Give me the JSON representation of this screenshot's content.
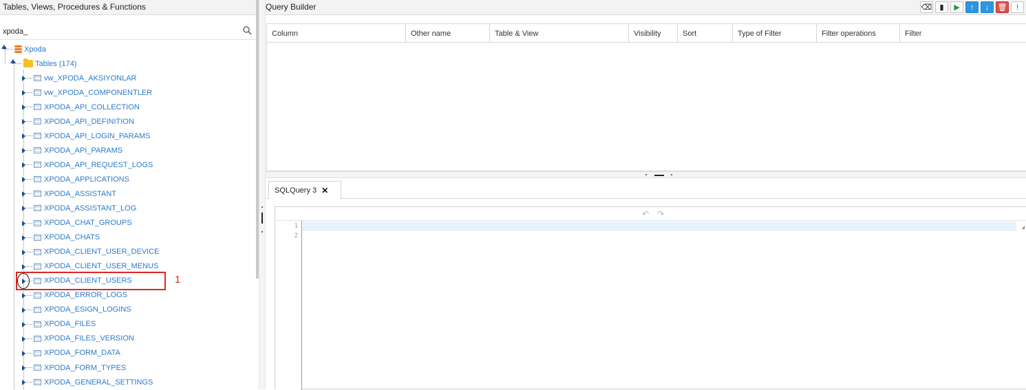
{
  "left_panel": {
    "title": "Tables, Views, Procedures & Functions",
    "search": {
      "value": "xpoda_",
      "icon": "search-icon"
    },
    "tree": {
      "root": {
        "label": "Xpoda",
        "icon": "database-icon"
      },
      "folder": {
        "label": "Tables (174)",
        "icon": "folder-icon"
      },
      "items": [
        "vw_XPODA_AKSIYONLAR",
        "vw_XPODA_COMPONENTLER",
        "XPODA_API_COLLECTION",
        "XPODA_API_DEFINITION",
        "XPODA_API_LOGIN_PARAMS",
        "XPODA_API_PARAMS",
        "XPODA_API_REQUEST_LOGS",
        "XPODA_APPLICATIONS",
        "XPODA_ASSISTANT",
        "XPODA_ASSISTANT_LOG",
        "XPODA_CHAT_GROUPS",
        "XPODA_CHATS",
        "XPODA_CLIENT_USER_DEVICE",
        "XPODA_CLIENT_USER_MENUS",
        "XPODA_CLIENT_USERS",
        "XPODA_ERROR_LOGS",
        "XPODA_ESIGN_LOGINS",
        "XPODA_FILES",
        "XPODA_FILES_VERSION",
        "XPODA_FORM_DATA",
        "XPODA_FORM_TYPES",
        "XPODA_GENERAL_SETTINGS"
      ]
    },
    "annotation": {
      "number": "1",
      "color": "#e02424"
    }
  },
  "query_builder": {
    "title": "Query Builder",
    "toolbar": [
      {
        "icon": "eraser-icon",
        "glyph": "⌫"
      },
      {
        "icon": "document-icon",
        "glyph": "▮"
      },
      {
        "icon": "play-icon",
        "glyph": "▶"
      },
      {
        "icon": "arrow-up-icon",
        "glyph": "↑"
      },
      {
        "icon": "arrow-down-icon",
        "glyph": "↓"
      },
      {
        "icon": "trash-icon",
        "glyph": "🗑"
      },
      {
        "icon": "alert-icon",
        "glyph": "!"
      }
    ],
    "columns": [
      "Column",
      "Other name",
      "Table & View",
      "Visibility",
      "Sort",
      "Type of Filter",
      "Filter operations",
      "Filter"
    ]
  },
  "editor": {
    "tab_label": "SQLQuery 3",
    "tab_close": "✕",
    "undo_glyph": "↶",
    "redo_glyph": "↷",
    "line_numbers": [
      "1",
      "2"
    ]
  },
  "colors": {
    "link": "#2b7ac9",
    "accent_blue": "#2c97de",
    "danger": "#d9534f",
    "highlight": "#e02424"
  }
}
